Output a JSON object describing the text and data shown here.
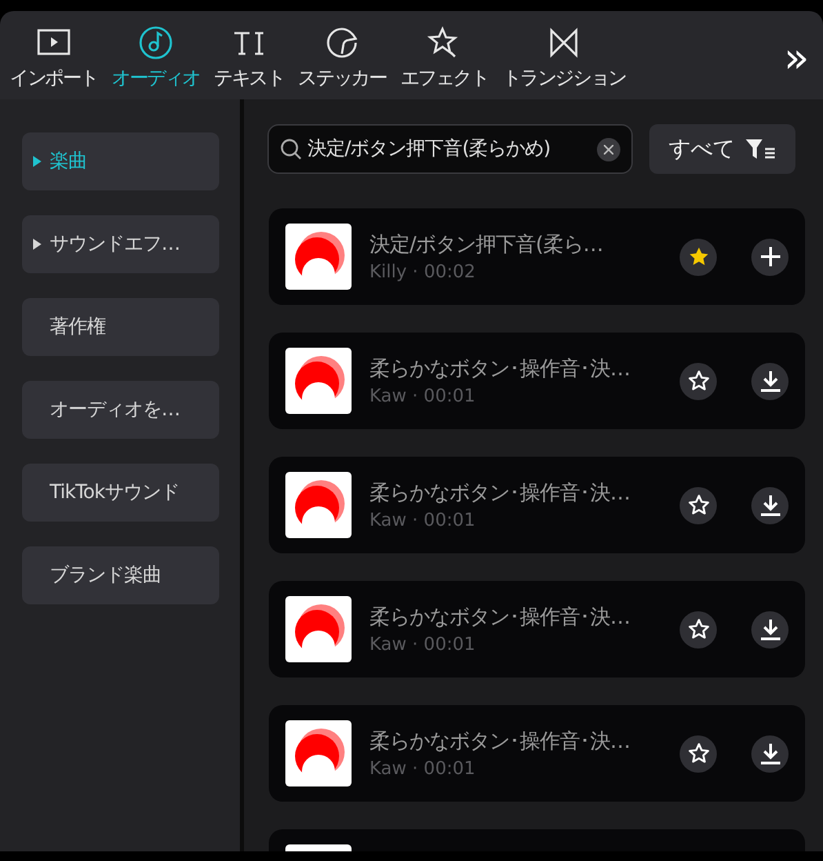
{
  "tabs": [
    {
      "label": "インポート",
      "kind": "import",
      "selected": false
    },
    {
      "label": "オーディオ",
      "kind": "audio",
      "selected": true
    },
    {
      "label": "テキスト",
      "kind": "text",
      "selected": false
    },
    {
      "label": "ステッカー",
      "kind": "sticker",
      "selected": false
    },
    {
      "label": "エフェクト",
      "kind": "effect",
      "selected": false
    },
    {
      "label": "トランジション",
      "kind": "transition",
      "selected": false
    }
  ],
  "more_tabs": "»",
  "sidebar": {
    "items": [
      {
        "label": "楽曲",
        "expandable": true,
        "selected": true
      },
      {
        "label": "サウンドエフ…",
        "expandable": true,
        "selected": false
      },
      {
        "label": "著作権",
        "expandable": false,
        "selected": false
      },
      {
        "label": "オーディオを…",
        "expandable": false,
        "selected": false
      },
      {
        "label": "TikTokサウンド",
        "expandable": false,
        "selected": false
      },
      {
        "label": "ブランド楽曲",
        "expandable": false,
        "selected": false
      }
    ]
  },
  "search": {
    "value": "決定/ボタン押下音(柔らかめ)"
  },
  "filter": {
    "label": "すべて"
  },
  "tracks": [
    {
      "kind": "add",
      "title": "決定/ボタン押下音(柔ら…",
      "meta": "Killy · 00:02",
      "favorited": true
    },
    {
      "kind": "download",
      "title": "柔らかなボタン･操作音･決…",
      "meta": "Kaw · 00:01",
      "favorited": false
    },
    {
      "kind": "download",
      "title": "柔らかなボタン･操作音･決…",
      "meta": "Kaw · 00:01",
      "favorited": false
    },
    {
      "kind": "download",
      "title": "柔らかなボタン･操作音･決…",
      "meta": "Kaw · 00:01",
      "favorited": false
    },
    {
      "kind": "download",
      "title": "柔らかなボタン･操作音･決…",
      "meta": "Kaw · 00:01",
      "favorited": false
    },
    {
      "kind": "cut"
    }
  ]
}
